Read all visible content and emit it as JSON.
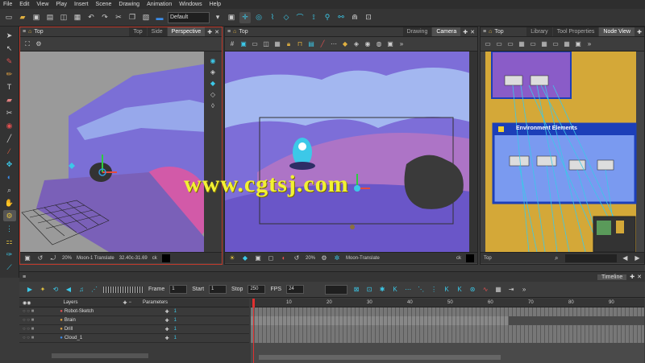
{
  "menu": [
    "File",
    "Edit",
    "View",
    "Play",
    "Insert",
    "Scene",
    "Drawing",
    "Animation",
    "Windows",
    "Help"
  ],
  "toolbar": {
    "preset": "Default"
  },
  "panel1": {
    "title": "Top",
    "tabs": [
      "Top",
      "Side",
      "Perspective"
    ],
    "active_tab": "Perspective",
    "zoom": "20%",
    "status": "Moon-1 Translate",
    "coords": "32.40c-31.69",
    "ck": "ck"
  },
  "panel2": {
    "title": "Top",
    "tabs": [
      "Drawing",
      "Camera"
    ],
    "active_tab": "Camera",
    "zoom": "20%",
    "status": "Moon-Translate",
    "ck": "ck"
  },
  "panel3": {
    "title": "Top",
    "tabs": [
      "Library",
      "Tool Properties",
      "Node View"
    ],
    "active_tab": "Node View",
    "node_group": "Environment Elements",
    "footer": "Top"
  },
  "watermark": "www.cgtsj.com",
  "timeline": {
    "title": "Timeline",
    "frame_label": "Frame",
    "frame": "1",
    "start_label": "Start",
    "start": "1",
    "stop_label": "Stop",
    "stop": "250",
    "fps_label": "FPS",
    "fps": "24",
    "layers_label": "Layers",
    "params_label": "Parameters",
    "ruler": [
      "10",
      "20",
      "30",
      "40",
      "50",
      "60",
      "70",
      "80",
      "90"
    ],
    "layers": [
      {
        "name": "Robot-Sketch",
        "param": "1"
      },
      {
        "name": "Brain",
        "param": "1"
      },
      {
        "name": "Drill",
        "param": "1"
      },
      {
        "name": "Cloud_1",
        "param": "1"
      }
    ]
  },
  "colors": {
    "sky": "#8a7ee0",
    "accent": "#3cc8e8",
    "selection": "#c0392b",
    "node_bg": "#d4a838",
    "node_group": "#1c3fb8"
  }
}
